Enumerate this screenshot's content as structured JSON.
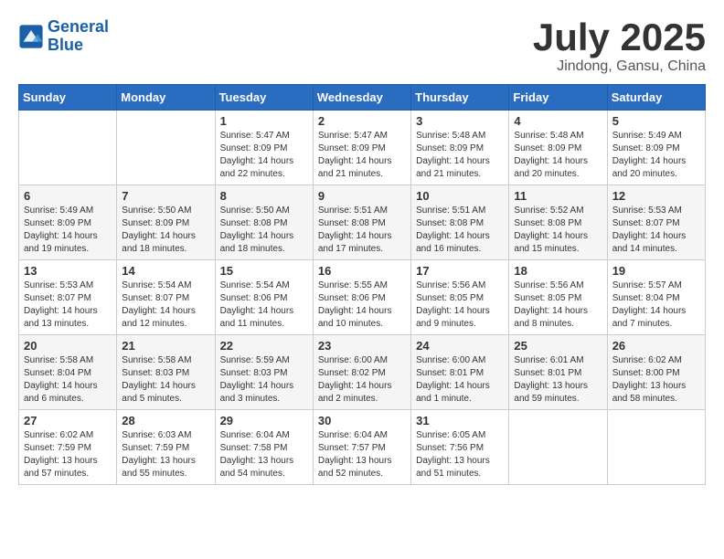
{
  "header": {
    "logo_line1": "General",
    "logo_line2": "Blue",
    "month_year": "July 2025",
    "location": "Jindong, Gansu, China"
  },
  "weekdays": [
    "Sunday",
    "Monday",
    "Tuesday",
    "Wednesday",
    "Thursday",
    "Friday",
    "Saturday"
  ],
  "weeks": [
    [
      {
        "day": "",
        "info": ""
      },
      {
        "day": "",
        "info": ""
      },
      {
        "day": "1",
        "info": "Sunrise: 5:47 AM\nSunset: 8:09 PM\nDaylight: 14 hours and 22 minutes."
      },
      {
        "day": "2",
        "info": "Sunrise: 5:47 AM\nSunset: 8:09 PM\nDaylight: 14 hours and 21 minutes."
      },
      {
        "day": "3",
        "info": "Sunrise: 5:48 AM\nSunset: 8:09 PM\nDaylight: 14 hours and 21 minutes."
      },
      {
        "day": "4",
        "info": "Sunrise: 5:48 AM\nSunset: 8:09 PM\nDaylight: 14 hours and 20 minutes."
      },
      {
        "day": "5",
        "info": "Sunrise: 5:49 AM\nSunset: 8:09 PM\nDaylight: 14 hours and 20 minutes."
      }
    ],
    [
      {
        "day": "6",
        "info": "Sunrise: 5:49 AM\nSunset: 8:09 PM\nDaylight: 14 hours and 19 minutes."
      },
      {
        "day": "7",
        "info": "Sunrise: 5:50 AM\nSunset: 8:09 PM\nDaylight: 14 hours and 18 minutes."
      },
      {
        "day": "8",
        "info": "Sunrise: 5:50 AM\nSunset: 8:08 PM\nDaylight: 14 hours and 18 minutes."
      },
      {
        "day": "9",
        "info": "Sunrise: 5:51 AM\nSunset: 8:08 PM\nDaylight: 14 hours and 17 minutes."
      },
      {
        "day": "10",
        "info": "Sunrise: 5:51 AM\nSunset: 8:08 PM\nDaylight: 14 hours and 16 minutes."
      },
      {
        "day": "11",
        "info": "Sunrise: 5:52 AM\nSunset: 8:08 PM\nDaylight: 14 hours and 15 minutes."
      },
      {
        "day": "12",
        "info": "Sunrise: 5:53 AM\nSunset: 8:07 PM\nDaylight: 14 hours and 14 minutes."
      }
    ],
    [
      {
        "day": "13",
        "info": "Sunrise: 5:53 AM\nSunset: 8:07 PM\nDaylight: 14 hours and 13 minutes."
      },
      {
        "day": "14",
        "info": "Sunrise: 5:54 AM\nSunset: 8:07 PM\nDaylight: 14 hours and 12 minutes."
      },
      {
        "day": "15",
        "info": "Sunrise: 5:54 AM\nSunset: 8:06 PM\nDaylight: 14 hours and 11 minutes."
      },
      {
        "day": "16",
        "info": "Sunrise: 5:55 AM\nSunset: 8:06 PM\nDaylight: 14 hours and 10 minutes."
      },
      {
        "day": "17",
        "info": "Sunrise: 5:56 AM\nSunset: 8:05 PM\nDaylight: 14 hours and 9 minutes."
      },
      {
        "day": "18",
        "info": "Sunrise: 5:56 AM\nSunset: 8:05 PM\nDaylight: 14 hours and 8 minutes."
      },
      {
        "day": "19",
        "info": "Sunrise: 5:57 AM\nSunset: 8:04 PM\nDaylight: 14 hours and 7 minutes."
      }
    ],
    [
      {
        "day": "20",
        "info": "Sunrise: 5:58 AM\nSunset: 8:04 PM\nDaylight: 14 hours and 6 minutes."
      },
      {
        "day": "21",
        "info": "Sunrise: 5:58 AM\nSunset: 8:03 PM\nDaylight: 14 hours and 5 minutes."
      },
      {
        "day": "22",
        "info": "Sunrise: 5:59 AM\nSunset: 8:03 PM\nDaylight: 14 hours and 3 minutes."
      },
      {
        "day": "23",
        "info": "Sunrise: 6:00 AM\nSunset: 8:02 PM\nDaylight: 14 hours and 2 minutes."
      },
      {
        "day": "24",
        "info": "Sunrise: 6:00 AM\nSunset: 8:01 PM\nDaylight: 14 hours and 1 minute."
      },
      {
        "day": "25",
        "info": "Sunrise: 6:01 AM\nSunset: 8:01 PM\nDaylight: 13 hours and 59 minutes."
      },
      {
        "day": "26",
        "info": "Sunrise: 6:02 AM\nSunset: 8:00 PM\nDaylight: 13 hours and 58 minutes."
      }
    ],
    [
      {
        "day": "27",
        "info": "Sunrise: 6:02 AM\nSunset: 7:59 PM\nDaylight: 13 hours and 57 minutes."
      },
      {
        "day": "28",
        "info": "Sunrise: 6:03 AM\nSunset: 7:59 PM\nDaylight: 13 hours and 55 minutes."
      },
      {
        "day": "29",
        "info": "Sunrise: 6:04 AM\nSunset: 7:58 PM\nDaylight: 13 hours and 54 minutes."
      },
      {
        "day": "30",
        "info": "Sunrise: 6:04 AM\nSunset: 7:57 PM\nDaylight: 13 hours and 52 minutes."
      },
      {
        "day": "31",
        "info": "Sunrise: 6:05 AM\nSunset: 7:56 PM\nDaylight: 13 hours and 51 minutes."
      },
      {
        "day": "",
        "info": ""
      },
      {
        "day": "",
        "info": ""
      }
    ]
  ]
}
